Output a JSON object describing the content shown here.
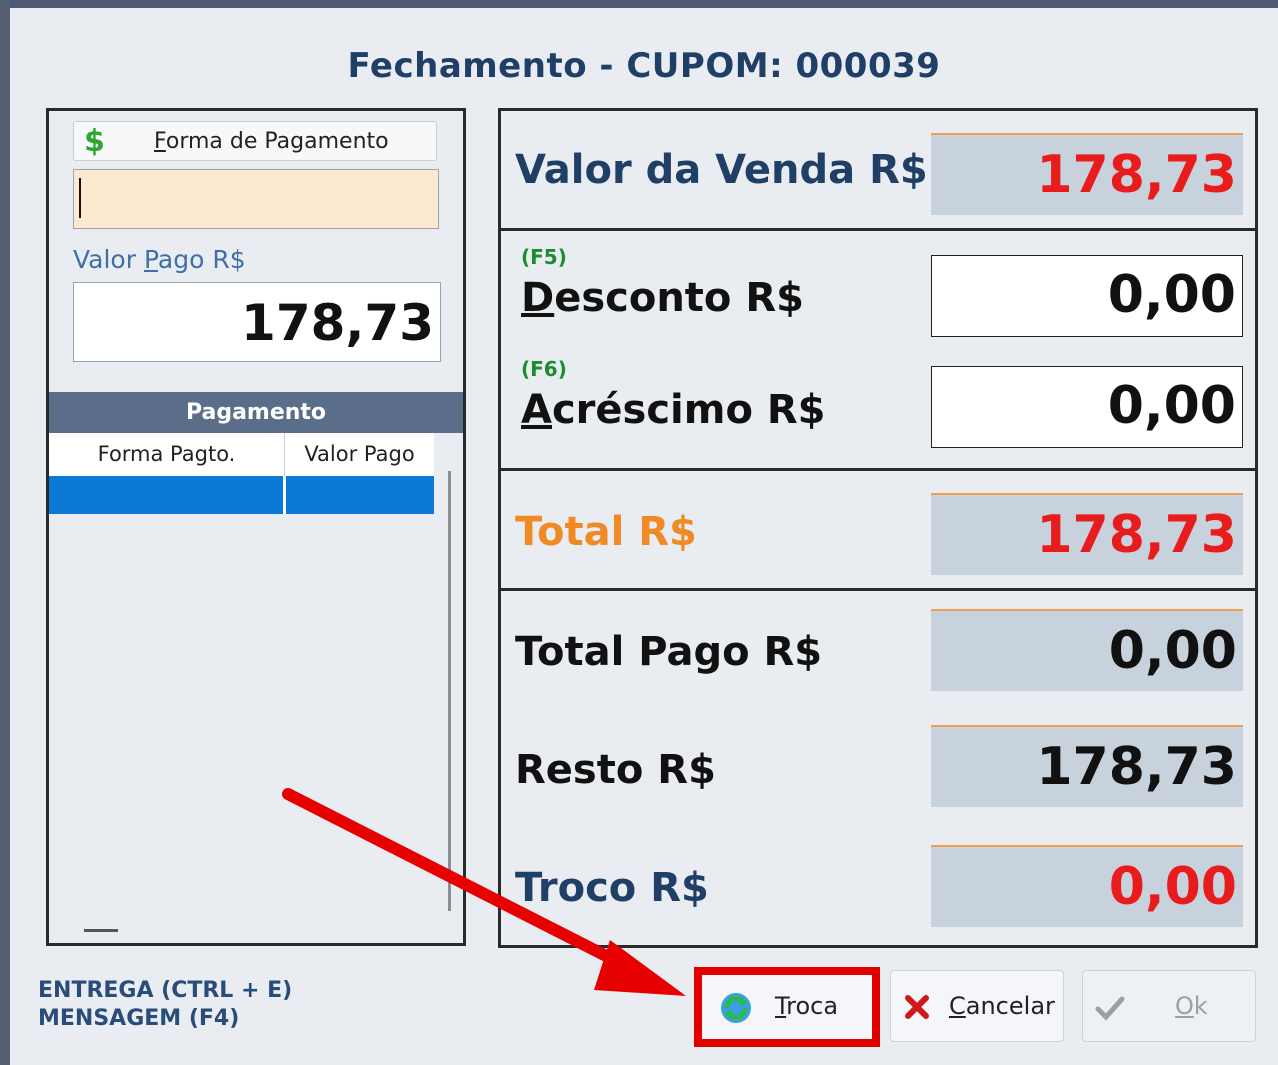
{
  "window": {
    "title": "Fechamento - CUPOM: 000039"
  },
  "left_panel": {
    "forma_pagamento_button": {
      "prefix": "",
      "accel": "F",
      "label": "orma de Pagamento",
      "icon": "dollar-icon"
    },
    "forma_input_value": "",
    "valor_pago": {
      "label_pre": "Valor ",
      "accel": "P",
      "label_post": "ago R$",
      "value": "178,73"
    },
    "pagamento_header": "Pagamento",
    "grid_columns": [
      "Forma Pagto.",
      "Valor Pago"
    ]
  },
  "right_panel": {
    "valor_venda": {
      "label": "Valor da Venda R$",
      "value": "178,73"
    },
    "desconto": {
      "fkey": "(F5)",
      "accel": "D",
      "label_rest": "esconto R$",
      "value": "0,00"
    },
    "acrescimo": {
      "fkey": "(F6)",
      "accel": "A",
      "label_rest": "créscimo R$",
      "value": "0,00"
    },
    "total": {
      "label": "Total R$",
      "value": "178,73"
    },
    "total_pago": {
      "label": "Total Pago R$",
      "value": "0,00"
    },
    "resto": {
      "label": "Resto R$",
      "value": "178,73"
    },
    "troco": {
      "label": "Troco R$",
      "value": "0,00"
    }
  },
  "footer": {
    "entrega": "ENTREGA (CTRL + E)",
    "mensagem": "MENSAGEM (F4)"
  },
  "buttons": {
    "troca": {
      "accel": "T",
      "rest": "roca",
      "icon": "refresh-icon"
    },
    "cancelar": {
      "accel": "C",
      "rest": "ancelar",
      "icon": "close-icon"
    },
    "ok": {
      "accel": "O",
      "rest": "k",
      "icon": "check-icon"
    }
  },
  "colors": {
    "title": "#1f3f66",
    "value_red": "#e81c1c",
    "total_orange": "#f08a24",
    "label_blue": "#1f3f66",
    "selection_blue": "#0a7ad6",
    "highlight_red": "#e10000"
  }
}
